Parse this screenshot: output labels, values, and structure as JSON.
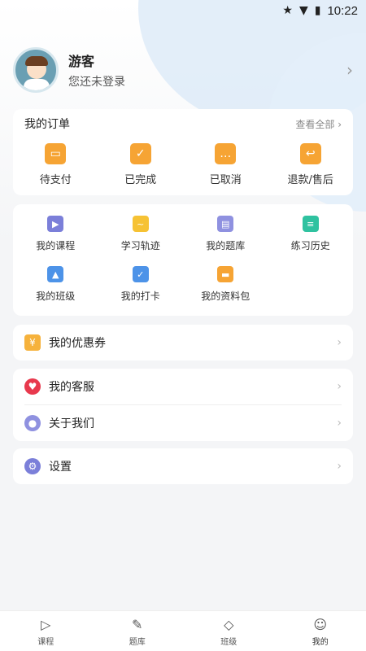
{
  "status_bar": {
    "time": "10:22"
  },
  "profile": {
    "name": "游客",
    "subtitle": "您还未登录"
  },
  "orders": {
    "title": "我的订单",
    "view_all": "查看全部",
    "items": [
      {
        "label": "待支付",
        "icon": "card-icon"
      },
      {
        "label": "已完成",
        "icon": "check-icon"
      },
      {
        "label": "已取消",
        "icon": "cancel-icon"
      },
      {
        "label": "退款/售后",
        "icon": "refund-icon"
      }
    ]
  },
  "features": {
    "items": [
      {
        "label": "我的课程",
        "icon": "course-icon",
        "color": "#7b7fd9"
      },
      {
        "label": "学习轨迹",
        "icon": "trace-icon",
        "color": "#f6c234"
      },
      {
        "label": "我的题库",
        "icon": "question-bank-icon",
        "color": "#7b7fd9"
      },
      {
        "label": "练习历史",
        "icon": "history-icon",
        "color": "#2fc2a0"
      },
      {
        "label": "我的班级",
        "icon": "class-icon",
        "color": "#4d93e8"
      },
      {
        "label": "我的打卡",
        "icon": "checkin-icon",
        "color": "#4d93e8"
      },
      {
        "label": "我的资料包",
        "icon": "folder-icon",
        "color": "#f6a434"
      }
    ]
  },
  "coupon": {
    "label": "我的优惠券"
  },
  "service": {
    "label": "我的客服"
  },
  "about": {
    "label": "关于我们"
  },
  "settings": {
    "label": "设置"
  },
  "tabbar": {
    "items": [
      {
        "label": "课程",
        "icon": "play-icon"
      },
      {
        "label": "题库",
        "icon": "pencil-icon"
      },
      {
        "label": "班级",
        "icon": "class-icon"
      },
      {
        "label": "我的",
        "icon": "user-icon"
      }
    ]
  },
  "colors": {
    "accent": "#f6a434",
    "background": "#f4f5f7"
  }
}
